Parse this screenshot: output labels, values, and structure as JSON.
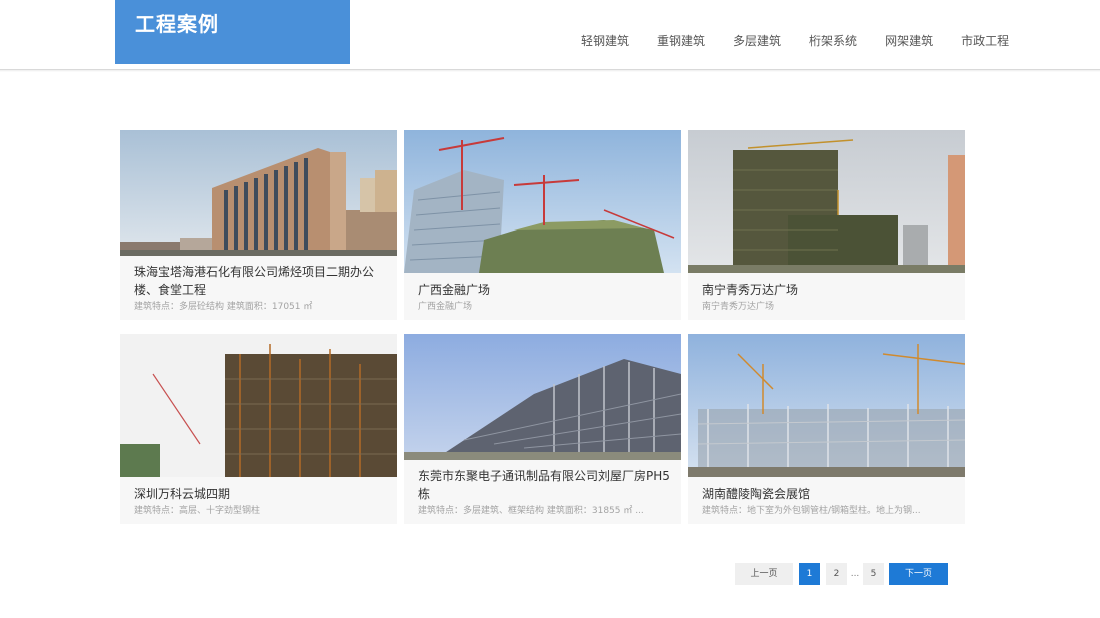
{
  "header": {
    "title": "工程案例",
    "nav": [
      "轻钢建筑",
      "重钢建筑",
      "多层建筑",
      "桁架系统",
      "网架建筑",
      "市政工程"
    ]
  },
  "cases": [
    {
      "name": "珠海宝塔海港石化有限公司烯烃项目二期办公楼、食堂工程",
      "desc": "建筑特点：多层砼结构 建筑面积：17051 ㎡"
    },
    {
      "name": "广西金融广场",
      "desc": "广西金融广场"
    },
    {
      "name": "南宁青秀万达广场",
      "desc": "南宁青秀万达广场"
    },
    {
      "name": "深圳万科云城四期",
      "desc": "建筑特点：高层、十字劲型钢柱"
    },
    {
      "name": "东莞市东聚电子通讯制品有限公司刘屋厂房PH5栋",
      "desc": "建筑特点：多层建筑、框架结构 建筑面积：31855 ㎡ ..."
    },
    {
      "name": "湖南醴陵陶瓷会展馆",
      "desc": "建筑特点：地下室为外包钢管柱/钢箱型柱。地上为钢..."
    }
  ],
  "pagination": {
    "prev": "上一页",
    "pages": [
      "1",
      "2",
      "5"
    ],
    "ellipsis": "...",
    "current": "1",
    "next": "下一页"
  }
}
